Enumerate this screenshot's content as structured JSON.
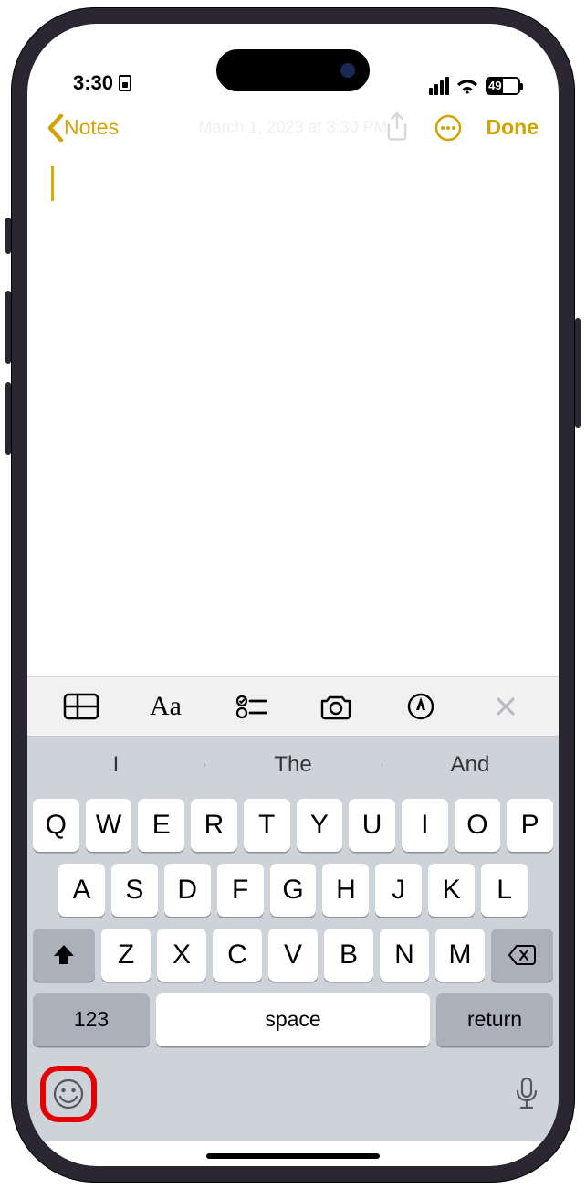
{
  "status": {
    "time": "3:30",
    "battery_pct": "49"
  },
  "nav": {
    "back_label": "Notes",
    "done_label": "Done",
    "ghost_date": "March 1, 2023 at 3:30 PM"
  },
  "accessory": {
    "icons": [
      "table",
      "text-format",
      "checklist",
      "camera",
      "markup",
      "close"
    ]
  },
  "suggestions": [
    "I",
    "The",
    "And"
  ],
  "keyboard": {
    "row1": [
      "Q",
      "W",
      "E",
      "R",
      "T",
      "Y",
      "U",
      "I",
      "O",
      "P"
    ],
    "row2": [
      "A",
      "S",
      "D",
      "F",
      "G",
      "H",
      "J",
      "K",
      "L"
    ],
    "row3": [
      "Z",
      "X",
      "C",
      "V",
      "B",
      "N",
      "M"
    ],
    "num_label": "123",
    "space_label": "space",
    "return_label": "return"
  },
  "colors": {
    "accent": "#d4a300"
  }
}
